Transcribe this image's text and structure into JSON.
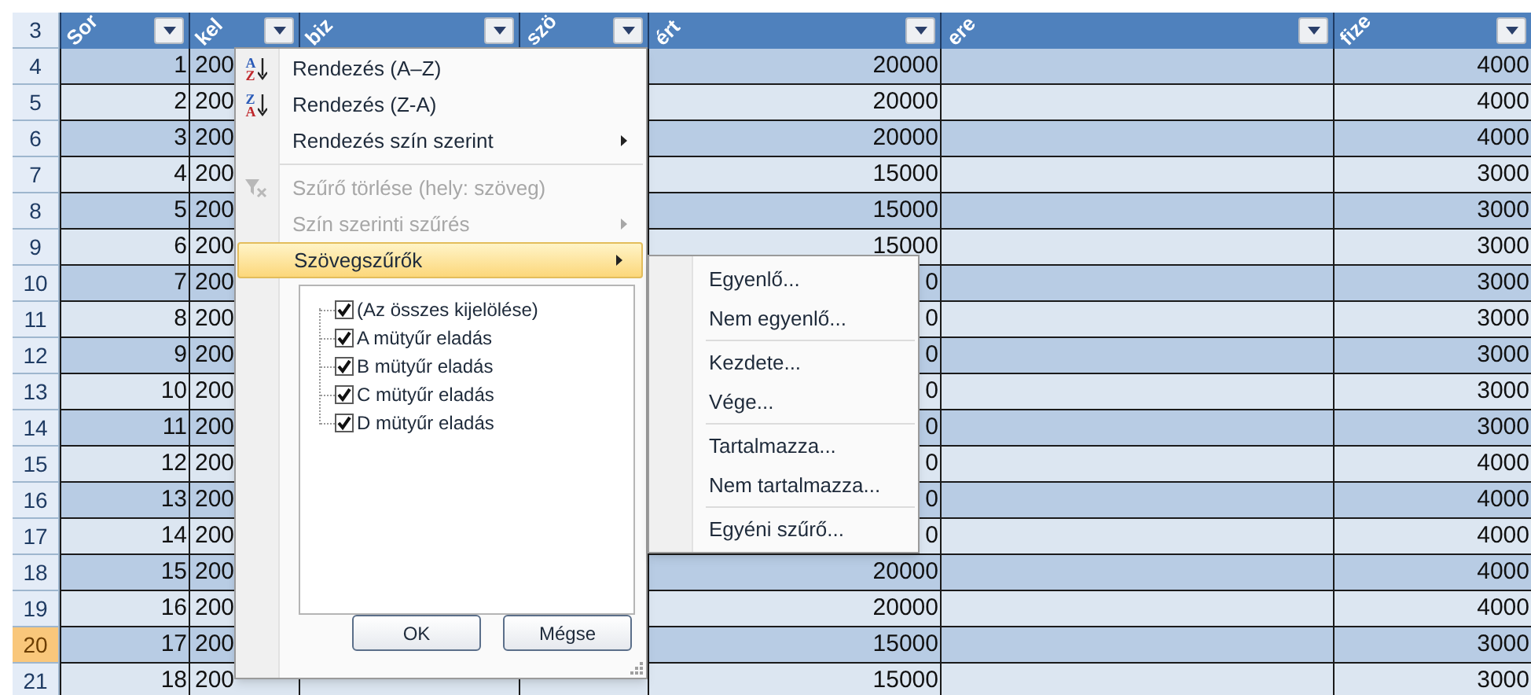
{
  "columns": [
    {
      "header": "Sor"
    },
    {
      "header": "kel"
    },
    {
      "header": "biz"
    },
    {
      "header": "szö"
    },
    {
      "header": "ért"
    },
    {
      "header": "ere"
    },
    {
      "header": "fize"
    }
  ],
  "header_row": {
    "row_number": "3"
  },
  "rows": [
    {
      "row_number": "4",
      "selected": false,
      "cells": [
        "1",
        "200",
        "",
        "",
        "20000",
        "",
        "4000"
      ]
    },
    {
      "row_number": "5",
      "selected": false,
      "cells": [
        "2",
        "200",
        "",
        "",
        "20000",
        "",
        "4000"
      ]
    },
    {
      "row_number": "6",
      "selected": false,
      "cells": [
        "3",
        "200",
        "",
        "",
        "20000",
        "",
        "4000"
      ]
    },
    {
      "row_number": "7",
      "selected": false,
      "cells": [
        "4",
        "200",
        "",
        "",
        "15000",
        "",
        "3000"
      ]
    },
    {
      "row_number": "8",
      "selected": false,
      "cells": [
        "5",
        "200",
        "",
        "",
        "15000",
        "",
        "3000"
      ]
    },
    {
      "row_number": "9",
      "selected": false,
      "cells": [
        "6",
        "200",
        "",
        "",
        "15000",
        "",
        "3000"
      ]
    },
    {
      "row_number": "10",
      "selected": false,
      "cells": [
        "7",
        "200",
        "",
        "",
        "0",
        "",
        "3000"
      ]
    },
    {
      "row_number": "11",
      "selected": false,
      "cells": [
        "8",
        "200",
        "",
        "",
        "0",
        "",
        "3000"
      ]
    },
    {
      "row_number": "12",
      "selected": false,
      "cells": [
        "9",
        "200",
        "",
        "",
        "0",
        "",
        "3000"
      ]
    },
    {
      "row_number": "13",
      "selected": false,
      "cells": [
        "10",
        "200",
        "",
        "",
        "0",
        "",
        "3000"
      ]
    },
    {
      "row_number": "14",
      "selected": false,
      "cells": [
        "11",
        "200",
        "",
        "",
        "0",
        "",
        "3000"
      ]
    },
    {
      "row_number": "15",
      "selected": false,
      "cells": [
        "12",
        "200",
        "",
        "",
        "0",
        "",
        "4000"
      ]
    },
    {
      "row_number": "16",
      "selected": false,
      "cells": [
        "13",
        "200",
        "",
        "",
        "0",
        "",
        "4000"
      ]
    },
    {
      "row_number": "17",
      "selected": false,
      "cells": [
        "14",
        "200",
        "",
        "",
        "0",
        "",
        "4000"
      ]
    },
    {
      "row_number": "18",
      "selected": false,
      "cells": [
        "15",
        "200",
        "",
        "",
        "20000",
        "",
        "4000"
      ]
    },
    {
      "row_number": "19",
      "selected": false,
      "cells": [
        "16",
        "200",
        "",
        "",
        "20000",
        "",
        "4000"
      ]
    },
    {
      "row_number": "20",
      "selected": true,
      "cells": [
        "17",
        "200",
        "",
        "",
        "15000",
        "",
        "3000"
      ]
    },
    {
      "row_number": "21",
      "selected": false,
      "cells": [
        "18",
        "200",
        "",
        "",
        "15000",
        "",
        "3000"
      ]
    }
  ],
  "filter_menu": {
    "items": [
      {
        "kind": "sort",
        "label": "Rendezés (A–Z)",
        "icon_letters": [
          "A",
          "Z"
        ],
        "disabled": false,
        "submenu": false,
        "selected": false
      },
      {
        "kind": "sort",
        "label": "Rendezés (Z-A)",
        "icon_letters": [
          "Z",
          "A"
        ],
        "disabled": false,
        "submenu": false,
        "selected": false
      },
      {
        "kind": "item",
        "label": "Rendezés szín szerint",
        "disabled": false,
        "submenu": true,
        "selected": false
      },
      {
        "kind": "separator"
      },
      {
        "kind": "clear",
        "label": "Szűrő törlése (hely: szöveg)",
        "disabled": true,
        "submenu": false,
        "selected": false
      },
      {
        "kind": "item",
        "label": "Szín szerinti szűrés",
        "disabled": true,
        "submenu": true,
        "selected": false
      },
      {
        "kind": "item",
        "label": "Szövegszűrők",
        "disabled": false,
        "submenu": true,
        "selected": true
      }
    ],
    "values": [
      {
        "label": "(Az összes kijelölése)",
        "checked": true
      },
      {
        "label": "A mütyűr eladás",
        "checked": true
      },
      {
        "label": "B mütyűr eladás",
        "checked": true
      },
      {
        "label": "C mütyűr eladás",
        "checked": true
      },
      {
        "label": "D mütyűr eladás",
        "checked": true
      }
    ],
    "buttons": [
      "OK",
      "Mégse"
    ]
  },
  "text_filters_submenu": {
    "items": [
      {
        "kind": "item",
        "label": "Egyenlő..."
      },
      {
        "kind": "item",
        "label": "Nem egyenlő..."
      },
      {
        "kind": "separator"
      },
      {
        "kind": "item",
        "label": "Kezdete..."
      },
      {
        "kind": "item",
        "label": "Vége..."
      },
      {
        "kind": "separator"
      },
      {
        "kind": "item",
        "label": "Tartalmazza..."
      },
      {
        "kind": "item",
        "label": "Nem tartalmazza..."
      },
      {
        "kind": "separator"
      },
      {
        "kind": "item",
        "label": "Egyéni szűrő..."
      }
    ]
  }
}
